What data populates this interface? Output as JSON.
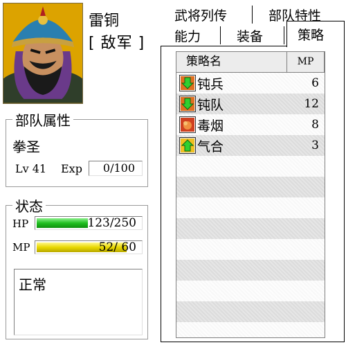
{
  "general": {
    "name": "雷铜",
    "faction": "[ 敌军 ]"
  },
  "troop": {
    "title": "部队属性",
    "type": "拳圣",
    "lv_label": "Lv 41",
    "exp_label": "Exp",
    "exp_value": "0/100"
  },
  "status": {
    "title": "状态",
    "hp_label": "HP",
    "hp_text": "123/250",
    "hp_fraction": 0.492,
    "mp_label": "MP",
    "mp_text": "52/ 60",
    "mp_fraction": 0.867,
    "condition": "正常"
  },
  "tabs": {
    "row1": [
      "武将列传",
      "部队特性"
    ],
    "row2": [
      "能力",
      "装备",
      "策略"
    ],
    "active": "策略"
  },
  "strategy_table": {
    "headers": {
      "name": "策略名",
      "mp": "MP"
    },
    "rows": [
      {
        "icon": "green-down-arrow-icon",
        "name": "钝兵",
        "mp": "6"
      },
      {
        "icon": "green-down-arrow-icon",
        "name": "钝队",
        "mp": "12"
      },
      {
        "icon": "poison-smoke-icon",
        "name": "毒烟",
        "mp": "8"
      },
      {
        "icon": "green-up-arrow-icon",
        "name": "气合",
        "mp": "3"
      }
    ],
    "empty_rows": 9
  },
  "colors": {
    "hp": "#1fbf1f",
    "mp": "#e8d800",
    "portrait_bg": "#e0a800"
  }
}
